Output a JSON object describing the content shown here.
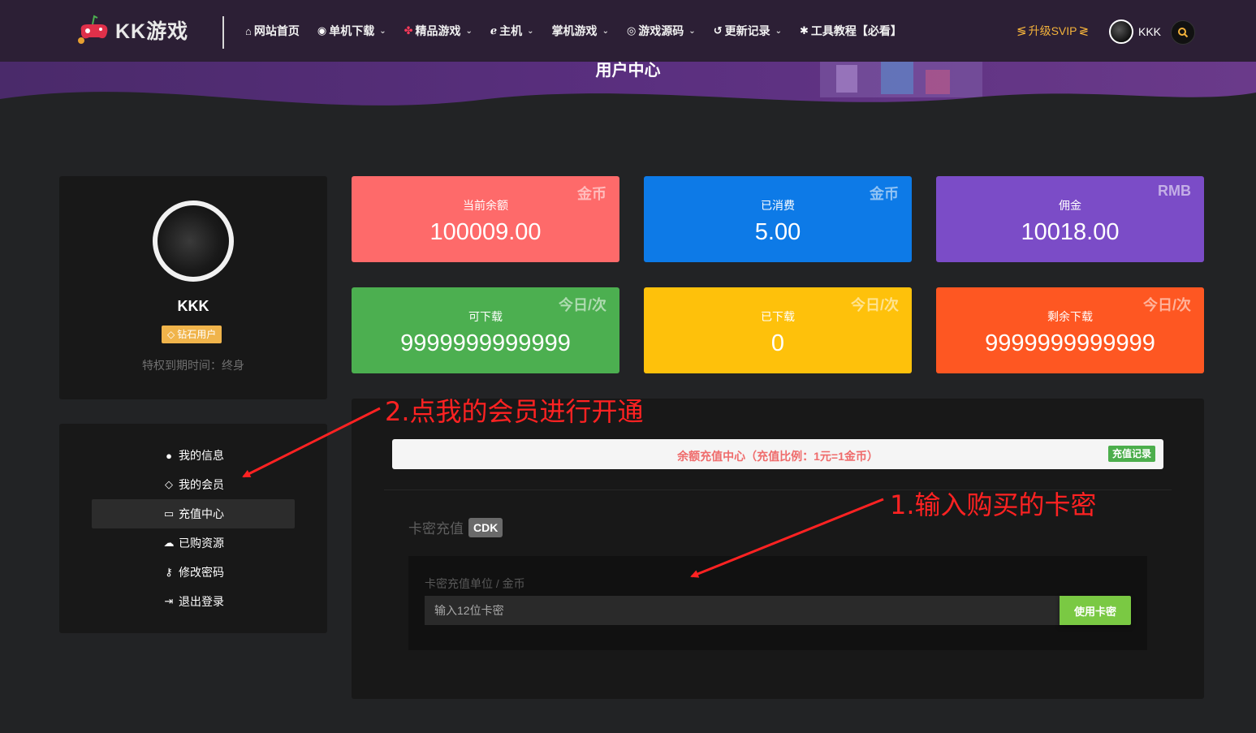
{
  "header": {
    "logo_text": "KK游戏",
    "nav": [
      {
        "icon": "home-icon",
        "glyph": "⌂",
        "label": "网站首页",
        "dropdown": false
      },
      {
        "icon": "gamepad-icon",
        "glyph": "◉",
        "label": "单机下载",
        "dropdown": true
      },
      {
        "icon": "pinwheel-icon",
        "glyph": "✤",
        "label": "精品游戏",
        "dropdown": true
      },
      {
        "icon": "e-icon",
        "glyph": "ℯ",
        "label": "主机",
        "dropdown": true
      },
      {
        "icon": "",
        "glyph": "",
        "label": "掌机游戏",
        "dropdown": true
      },
      {
        "icon": "compass-icon",
        "glyph": "◎",
        "label": "游戏源码",
        "dropdown": true
      },
      {
        "icon": "history-icon",
        "glyph": "↺",
        "label": "更新记录",
        "dropdown": true
      },
      {
        "icon": "bug-icon",
        "glyph": "✱",
        "label": "工具教程【必看】",
        "dropdown": false
      }
    ],
    "svip_label": "升级SVIP",
    "user_name": "KKK"
  },
  "banner": {
    "title": "用户中心"
  },
  "profile": {
    "name": "KKK",
    "badge": "钻石用户",
    "expire": "特权到期时间：终身"
  },
  "stats": [
    {
      "label": "当前余额",
      "value": "100009.00",
      "tag": "金币",
      "color": "#fe6a6a"
    },
    {
      "label": "已消费",
      "value": "5.00",
      "tag": "金币",
      "color": "#0d7ae7"
    },
    {
      "label": "佣金",
      "value": "10018.00",
      "tag": "RMB",
      "color": "#7b4cc7"
    },
    {
      "label": "可下载",
      "value": "9999999999999",
      "tag": "今日/次",
      "color": "#4caf50"
    },
    {
      "label": "已下载",
      "value": "0",
      "tag": "今日/次",
      "color": "#fec10b"
    },
    {
      "label": "剩余下载",
      "value": "9999999999999",
      "tag": "今日/次",
      "color": "#fe5722"
    }
  ],
  "menu": [
    {
      "icon": "user-icon",
      "glyph": "●",
      "label": "我的信息"
    },
    {
      "icon": "diamond-icon",
      "glyph": "◇",
      "label": "我的会员"
    },
    {
      "icon": "credit-card-icon",
      "glyph": "▭",
      "label": "充值中心",
      "active": true
    },
    {
      "icon": "cloud-download-icon",
      "glyph": "☁",
      "label": "已购资源"
    },
    {
      "icon": "key-icon",
      "glyph": "⚷",
      "label": "修改密码"
    },
    {
      "icon": "sign-out-icon",
      "glyph": "⇥",
      "label": "退出登录"
    }
  ],
  "recharge": {
    "notice": "余额充值中心（充值比例：1元=1金币）",
    "records_label": "充值记录",
    "cdk_title": "卡密充值",
    "cdk_tag": "CDK",
    "unit_label": "卡密充值单位 / 金币",
    "input_placeholder": "输入12位卡密",
    "input_value": "",
    "submit_label": "使用卡密"
  },
  "annotations": {
    "step2": "2.点我的会员进行开通",
    "step1": "1.输入购买的卡密"
  },
  "colors": {
    "header_bg": "#2c1f35",
    "page_bg": "#222325",
    "card_bg": "#181818",
    "accent_gold": "#f3b23b",
    "accent_green": "#7ac943",
    "annotation_red": "#ff2222"
  }
}
